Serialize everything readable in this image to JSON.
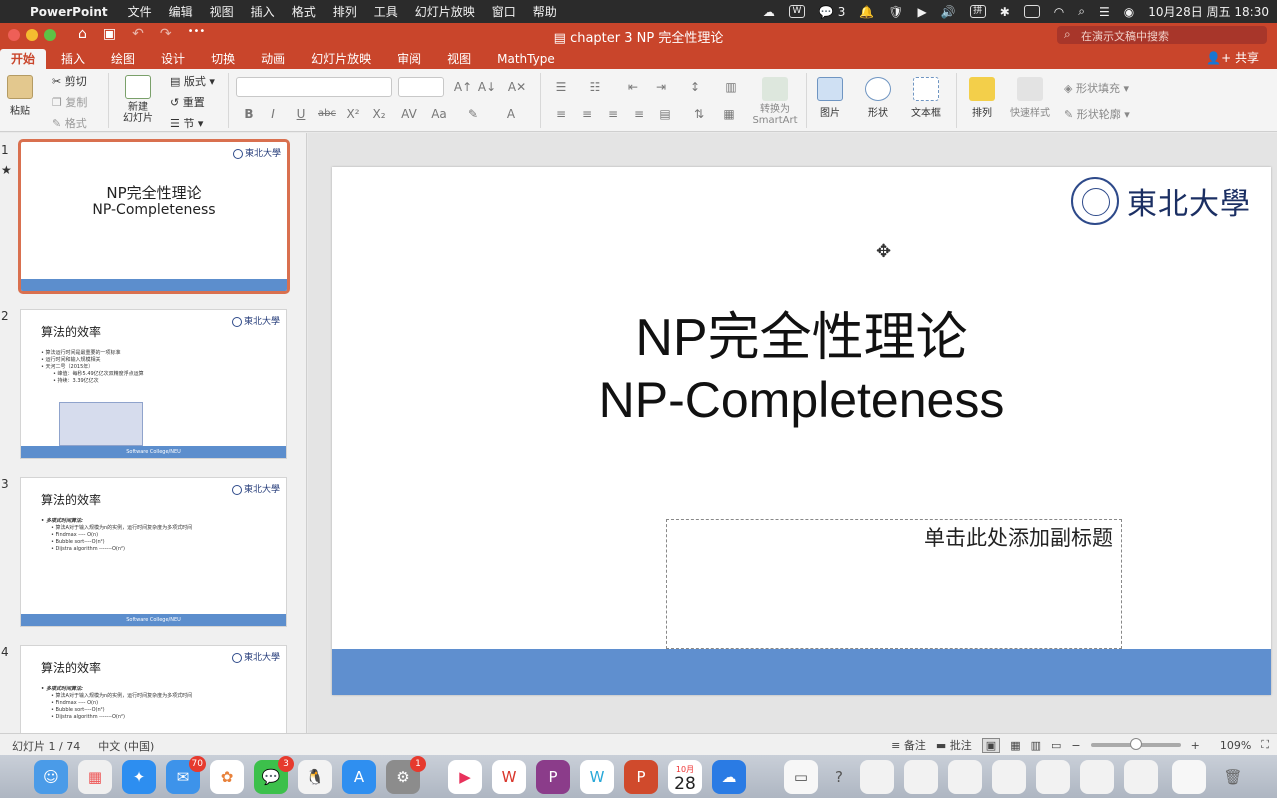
{
  "menubar": {
    "app_name": "PowerPoint",
    "items": [
      "文件",
      "编辑",
      "视图",
      "插入",
      "格式",
      "排列",
      "工具",
      "幻灯片放映",
      "窗口",
      "帮助"
    ],
    "wechat_count": "3",
    "clock": "10月28日 周五  18:30",
    "input_method": "拼"
  },
  "titlebar": {
    "title": "chapter 3 NP 完全性理论",
    "search_placeholder": "在演示文稿中搜索"
  },
  "tabs": [
    "开始",
    "插入",
    "绘图",
    "设计",
    "切换",
    "动画",
    "幻灯片放映",
    "审阅",
    "视图",
    "MathType"
  ],
  "share_label": "共享",
  "ribbon": {
    "paste": "粘贴",
    "cut": "剪切",
    "copy": "复制",
    "format": "格式",
    "new_slide": "新建\n幻灯片",
    "layout": "版式",
    "reset": "重置",
    "section": "节",
    "convert_smartart": "转换为\nSmartArt",
    "picture": "图片",
    "shape": "形状",
    "textbox": "文本框",
    "arrange": "排列",
    "quick_styles": "快速样式",
    "shape_fill": "形状填充",
    "shape_outline": "形状轮廓"
  },
  "slides": [
    {
      "num": "1",
      "title": "NP完全性理论",
      "subtitle": "NP-Completeness"
    },
    {
      "num": "2",
      "title": "算法的效率",
      "bullets": [
        "算法运行时间是最重要的一项标准",
        "运行时间和输入规模相关",
        "天河二号（2015年）",
        "峰值：每秒5.49亿亿次双精度浮点运算",
        "持续：3.39亿亿次"
      ],
      "footer": "Software College/NEU"
    },
    {
      "num": "3",
      "title": "算法的效率",
      "bullets": [
        "多项式时间算法:",
        "算法A对于输入规模为n的实例，运行时间复杂度为多项式时间",
        "Findmax ---- O(n)",
        "Bubble sort----O(n²)",
        "Dijstra algorithm -------O(n²)"
      ],
      "footer": "Software College/NEU"
    },
    {
      "num": "4",
      "title": "算法的效率",
      "bullets": [
        "多项式时间算法:",
        "算法A对于输入规模为n的实例，运行时间复杂度为多项式时间",
        "Findmax ---- O(n)",
        "Bubble sort----O(n²)",
        "Dijstra algorithm -------O(n²)"
      ]
    }
  ],
  "current_slide": {
    "logo_text": "東北大學",
    "title": "NP完全性理论",
    "subtitle": "NP-Completeness",
    "subtitle_placeholder": "单击此处添加副标题"
  },
  "status": {
    "slide_counter": "幻灯片 1 / 74",
    "language": "中文 (中国)",
    "notes": "备注",
    "comments": "批注",
    "zoom": "109%",
    "zoom_fraction": 0.5
  },
  "dock": {
    "mail_badge": "70",
    "wechat_badge": "3",
    "settings_badge": "1",
    "calendar_month": "10月",
    "calendar_day": "28"
  }
}
